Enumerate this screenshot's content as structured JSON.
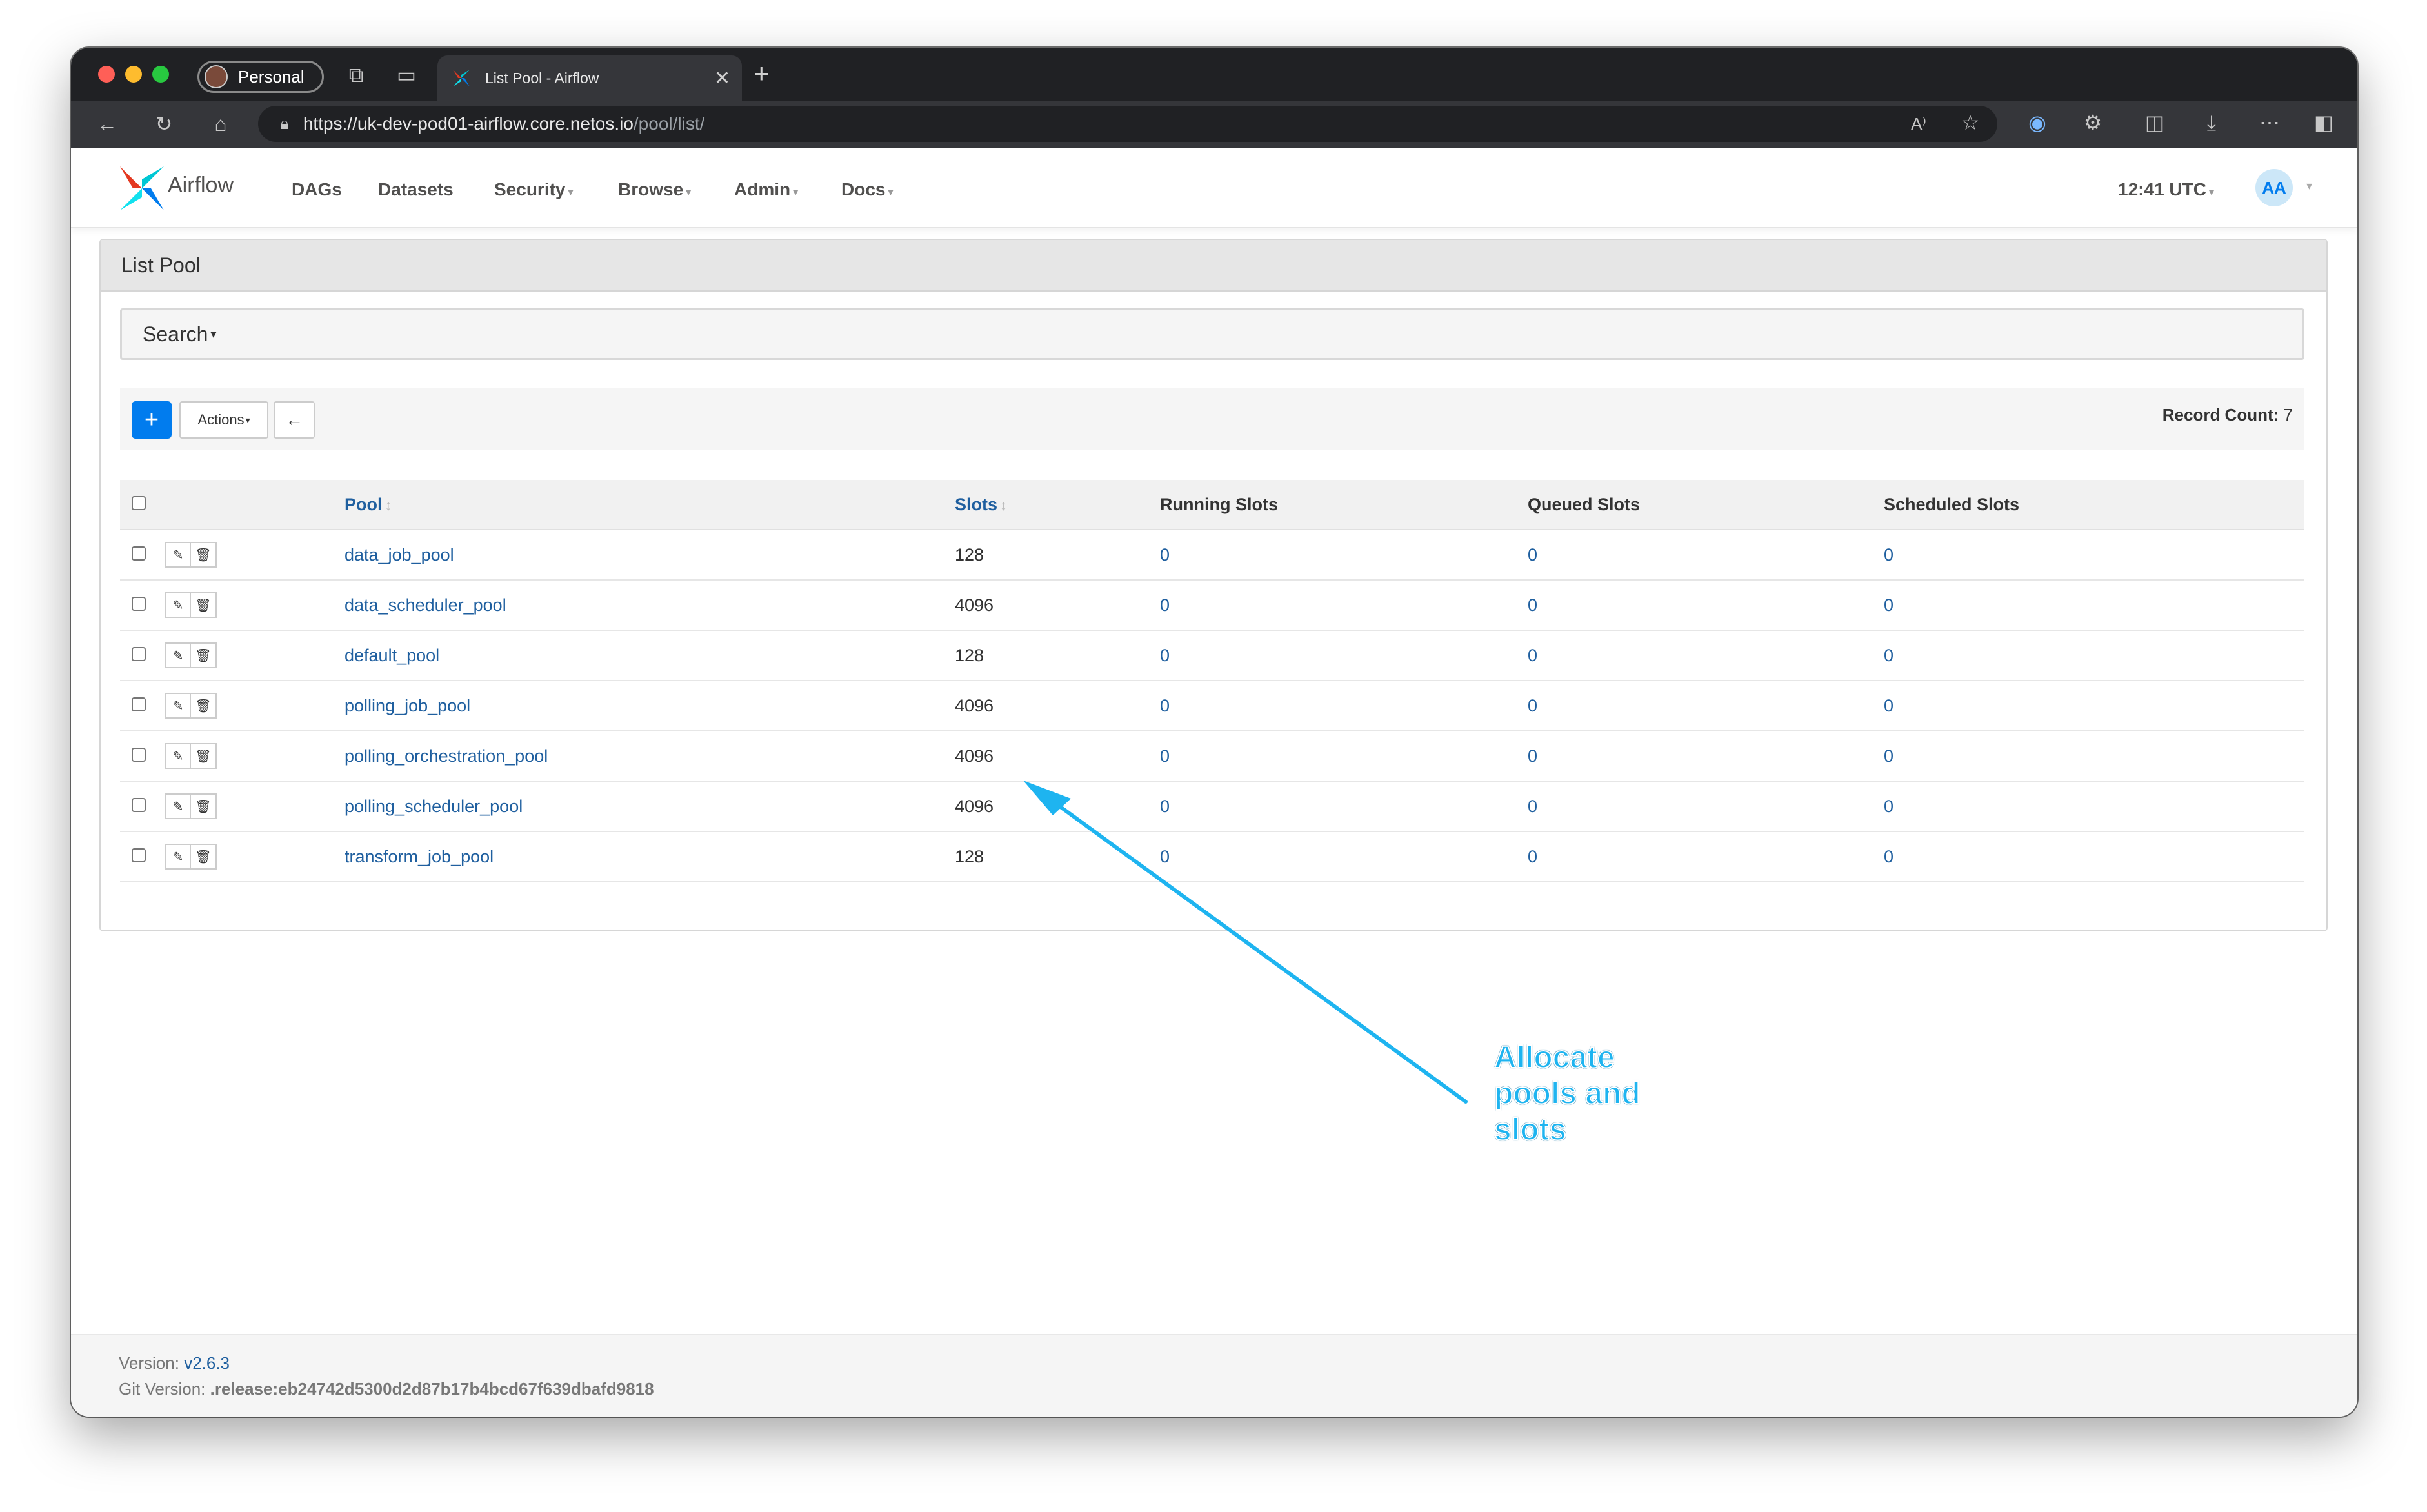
{
  "browser": {
    "profile_label": "Personal",
    "tab_title": "List Pool - Airflow",
    "url_host": "https://uk-dev-pod01-airflow.core.netos.io",
    "url_path": "/pool/list/"
  },
  "navbar": {
    "brand": "Airflow",
    "items": [
      "DAGs",
      "Datasets",
      "Security",
      "Browse",
      "Admin",
      "Docs"
    ],
    "clock": "12:41 UTC",
    "user_initials": "AA"
  },
  "panel": {
    "title": "List Pool",
    "search_label": "Search",
    "actions_label": "Actions",
    "add_label": "+",
    "back_label": "←",
    "record_count_label": "Record Count:",
    "record_count_value": "7"
  },
  "table": {
    "columns": [
      "Pool",
      "Slots",
      "Running Slots",
      "Queued Slots",
      "Scheduled Slots"
    ],
    "rows": [
      {
        "pool": "data_job_pool",
        "slots": "128",
        "running": "0",
        "queued": "0",
        "scheduled": "0"
      },
      {
        "pool": "data_scheduler_pool",
        "slots": "4096",
        "running": "0",
        "queued": "0",
        "scheduled": "0"
      },
      {
        "pool": "default_pool",
        "slots": "128",
        "running": "0",
        "queued": "0",
        "scheduled": "0"
      },
      {
        "pool": "polling_job_pool",
        "slots": "4096",
        "running": "0",
        "queued": "0",
        "scheduled": "0"
      },
      {
        "pool": "polling_orchestration_pool",
        "slots": "4096",
        "running": "0",
        "queued": "0",
        "scheduled": "0"
      },
      {
        "pool": "polling_scheduler_pool",
        "slots": "4096",
        "running": "0",
        "queued": "0",
        "scheduled": "0"
      },
      {
        "pool": "transform_job_pool",
        "slots": "128",
        "running": "0",
        "queued": "0",
        "scheduled": "0"
      }
    ]
  },
  "footer": {
    "version_label": "Version:",
    "version_value": "v2.6.3",
    "git_label": "Git Version:",
    "git_value": ".release:eb24742d5300d2d87b17b4bcd67f639dbafd9818"
  },
  "annotation": {
    "lines": [
      "Allocate",
      "pools and",
      "slots"
    ],
    "color": "#1eb4f0"
  }
}
